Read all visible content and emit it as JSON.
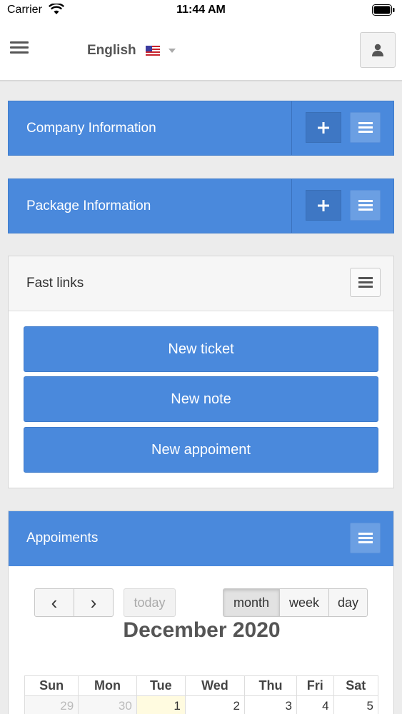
{
  "status": {
    "carrier": "Carrier",
    "time": "11:44 AM"
  },
  "header": {
    "language": "English"
  },
  "panels": {
    "company": {
      "title": "Company Information"
    },
    "package": {
      "title": "Package Information"
    },
    "fast_links": {
      "title": "Fast links",
      "buttons": [
        "New ticket",
        "New note",
        "New appoiment"
      ]
    },
    "appointments": {
      "title": "Appoiments"
    }
  },
  "calendar": {
    "prev_symbol": "‹",
    "next_symbol": "›",
    "today_label": "today",
    "views": [
      "month",
      "week",
      "day"
    ],
    "active_view": "month",
    "title": "December 2020",
    "weekdays": [
      "Sun",
      "Mon",
      "Tue",
      "Wed",
      "Thu",
      "Fri",
      "Sat"
    ],
    "first_row": [
      "29",
      "30",
      "1",
      "2",
      "3",
      "4",
      "5"
    ]
  },
  "colors": {
    "primary": "#4a89dc",
    "primary_dark": "#3e77c4",
    "background": "#ececec"
  }
}
